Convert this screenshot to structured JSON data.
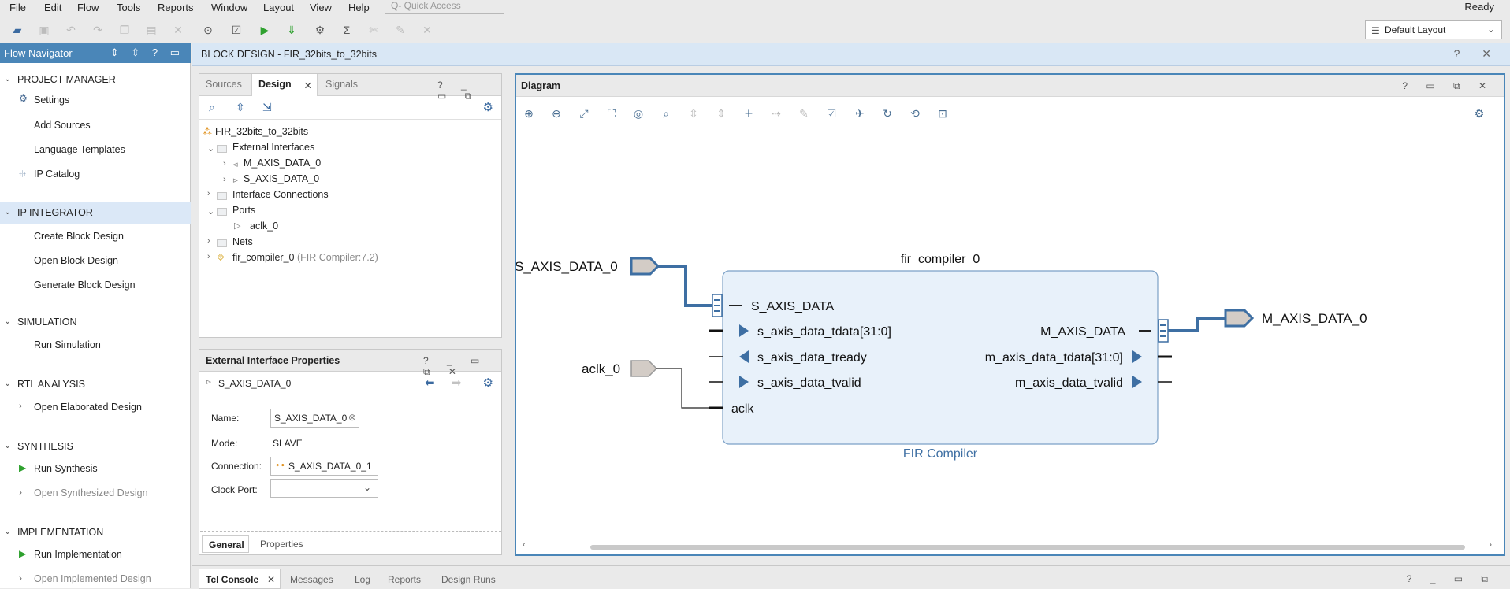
{
  "menubar": {
    "items": [
      "File",
      "Edit",
      "Flow",
      "Tools",
      "Reports",
      "Window",
      "Layout",
      "View",
      "Help"
    ],
    "quick_access_placeholder": "Q- Quick Access",
    "status": "Ready"
  },
  "toolbar": {
    "layout_select": "Default Layout"
  },
  "flow_navigator": {
    "title": "Flow Navigator",
    "project_manager": {
      "title": "PROJECT MANAGER",
      "items": [
        "Settings",
        "Add Sources",
        "Language Templates",
        "IP Catalog"
      ]
    },
    "ip_integrator": {
      "title": "IP INTEGRATOR",
      "items": [
        "Create Block Design",
        "Open Block Design",
        "Generate Block Design"
      ]
    },
    "simulation": {
      "title": "SIMULATION",
      "items": [
        "Run Simulation"
      ]
    },
    "rtl_analysis": {
      "title": "RTL ANALYSIS",
      "items": [
        "Open Elaborated Design"
      ]
    },
    "synthesis": {
      "title": "SYNTHESIS",
      "items": [
        "Run Synthesis",
        "Open Synthesized Design"
      ]
    },
    "implementation": {
      "title": "IMPLEMENTATION",
      "items": [
        "Run Implementation",
        "Open Implemented Design"
      ]
    }
  },
  "block_design": {
    "title": "BLOCK DESIGN - FIR_32bits_to_32bits"
  },
  "sources_panel": {
    "tabs": [
      "Sources",
      "Design",
      "Signals"
    ],
    "tree": {
      "root": "FIR_32bits_to_32bits",
      "external_interfaces": "External Interfaces",
      "m_axis": "M_AXIS_DATA_0",
      "s_axis": "S_AXIS_DATA_0",
      "interface_connections": "Interface Connections",
      "ports": "Ports",
      "aclk": "aclk_0",
      "nets": "Nets",
      "fir": "fir_compiler_0",
      "fir_type": "(FIR Compiler:7.2)"
    }
  },
  "properties_panel": {
    "title": "External Interface Properties",
    "selected": "S_AXIS_DATA_0",
    "name_label": "Name:",
    "name_value": "S_AXIS_DATA_0",
    "mode_label": "Mode:",
    "mode_value": "SLAVE",
    "connection_label": "Connection:",
    "connection_value": "S_AXIS_DATA_0_1",
    "clock_port_label": "Clock Port:",
    "tabs": [
      "General",
      "Properties"
    ]
  },
  "diagram": {
    "title": "Diagram",
    "block_name": "fir_compiler_0",
    "block_type": "FIR Compiler",
    "ext_in": "S_AXIS_DATA_0",
    "ext_clk": "aclk_0",
    "ext_out": "M_AXIS_DATA_0",
    "in_bus": "S_AXIS_DATA",
    "in_tdata": "s_axis_data_tdata[31:0]",
    "in_tready": "s_axis_data_tready",
    "in_tvalid": "s_axis_data_tvalid",
    "aclk": "aclk",
    "out_bus": "M_AXIS_DATA",
    "out_tdata": "m_axis_data_tdata[31:0]",
    "out_tvalid": "m_axis_data_tvalid"
  },
  "console_tabs": [
    "Tcl Console",
    "Messages",
    "Log",
    "Reports",
    "Design Runs"
  ],
  "colors": {
    "accent": "#4a86b8",
    "selection": "#dbe8f7",
    "block_fill": "#e8f1fa",
    "wire": "#3e6fa3"
  }
}
